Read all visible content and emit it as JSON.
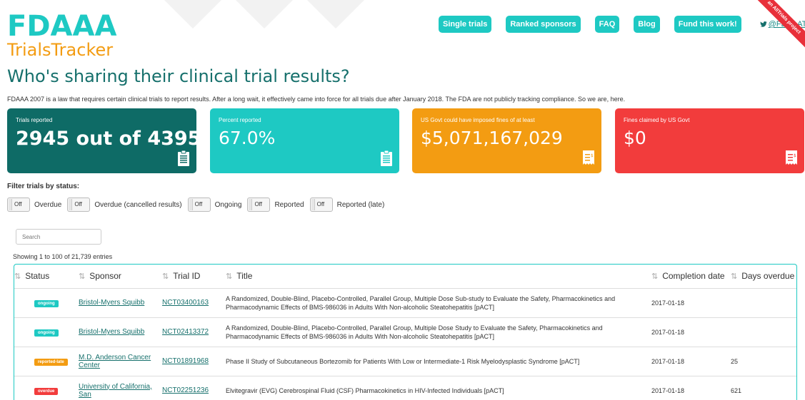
{
  "logo": {
    "line1": "FDAAA",
    "line2": "TrialsTracker"
  },
  "nav": {
    "items": [
      "Single trials",
      "Ranked sponsors",
      "FAQ",
      "Blog",
      "Fund this work!"
    ],
    "twitter": "@FDAAATracker"
  },
  "ribbon": {
    "text": "an AllTrials project"
  },
  "page": {
    "title": "Who's sharing their clinical trial results?",
    "intro": "FDAAA 2007 is a law that requires certain clinical trials to report results. After a long wait, it effectively came into force for all trials due after January 2018. The FDA are not publicly tracking compliance. So we are, here."
  },
  "cards": [
    {
      "label": "Trials reported",
      "value": "2945 out of 4395",
      "color": "#0e6b66"
    },
    {
      "label": "Percent reported",
      "value": "67.0%",
      "color": "#1ec9c3"
    },
    {
      "label": "US Govt could have imposed fines of at least",
      "value": "$5,071,167,029",
      "color": "#f39c12"
    },
    {
      "label": "Fines claimed by US Govt",
      "value": "$0",
      "color": "#f23c3c"
    }
  ],
  "filters": {
    "title": "Filter trials by status:",
    "toggle_text": "Off",
    "items": [
      "Overdue",
      "Overdue (cancelled results)",
      "Ongoing",
      "Reported",
      "Reported (late)"
    ]
  },
  "search": {
    "placeholder": "Search"
  },
  "entries": "Showing 1 to 100 of 21,739 entries",
  "table": {
    "columns": [
      "Status",
      "Sponsor",
      "Trial ID",
      "Title",
      "Completion date",
      "Days overdue"
    ],
    "rows": [
      {
        "status": "ongoing",
        "status_color": "#1ec9c3",
        "sponsor": "Bristol-Myers Squibb",
        "trial_id": "NCT03400163",
        "title": "A Randomized, Double-Blind, Placebo-Controlled, Parallel Group, Multiple Dose Sub-study to Evaluate the Safety, Pharmacokinetics and Pharmacodynamic Effects of BMS-986036 in Adults With Non-alcoholic Steatohepatitis [pACT]",
        "completion": "2017-01-18",
        "days": ""
      },
      {
        "status": "ongoing",
        "status_color": "#1ec9c3",
        "sponsor": "Bristol-Myers Squibb",
        "trial_id": "NCT02413372",
        "title": "A Randomized, Double-Blind, Placebo-Controlled, Parallel Group, Multiple Dose Study to Evaluate the Safety, Pharmacokinetics and Pharmacodynamic Effects of BMS-986036 in Adults With Non-alcoholic Steatohepatitis [pACT]",
        "completion": "2017-01-18",
        "days": ""
      },
      {
        "status": "reported-late",
        "status_color": "#f39c12",
        "sponsor": "M.D. Anderson Cancer Center",
        "trial_id": "NCT01891968",
        "title": "Phase II Study of Subcutaneous Bortezomib for Patients With Low or Intermediate-1 Risk Myelodysplastic Syndrome [pACT]",
        "completion": "2017-01-18",
        "days": "25"
      },
      {
        "status": "overdue",
        "status_color": "#f23c3c",
        "sponsor": "University of California, San",
        "trial_id": "NCT02251236",
        "title": "Elvitegravir (EVG) Cerebrospinal Fluid (CSF) Pharmacokinetics in HIV-Infected Individuals [pACT]",
        "completion": "2017-01-18",
        "days": "621"
      }
    ]
  }
}
